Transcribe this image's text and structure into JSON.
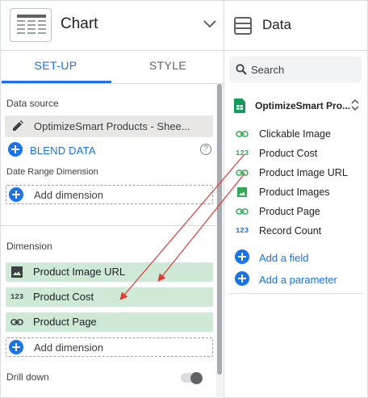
{
  "chart_panel": {
    "title": "Chart",
    "tabs": [
      {
        "label": "SET-UP",
        "active": true
      },
      {
        "label": "STYLE",
        "active": false
      }
    ],
    "data_source": {
      "section_label": "Data source",
      "name": "OptimizeSmart Products - Shee...",
      "blend_label": "BLEND DATA",
      "help_glyph": "?"
    },
    "date_range": {
      "section_label": "Date Range Dimension",
      "add_label": "Add dimension"
    },
    "dimension": {
      "section_label": "Dimension",
      "items": [
        {
          "icon": "image-icon",
          "type_glyph": "",
          "label": "Product Image URL"
        },
        {
          "icon": "number-icon",
          "type_glyph": "123",
          "label": "Product Cost"
        },
        {
          "icon": "link-icon",
          "type_glyph": "",
          "label": "Product Page"
        }
      ],
      "add_label": "Add dimension"
    },
    "drill_down": {
      "label": "Drill down",
      "enabled": false
    }
  },
  "data_panel": {
    "title": "Data",
    "search_placeholder": "Search",
    "source_name": "OptimizeSmart Pro...",
    "fields": [
      {
        "icon": "link-icon",
        "type_glyph": "",
        "label": "Clickable Image"
      },
      {
        "icon": "number-icon",
        "type_glyph": "123",
        "label": "Product Cost"
      },
      {
        "icon": "link-icon",
        "type_glyph": "",
        "label": "Product Image URL"
      },
      {
        "icon": "image-icon",
        "type_glyph": "",
        "label": "Product Images"
      },
      {
        "icon": "link-icon",
        "type_glyph": "",
        "label": "Product Page"
      },
      {
        "icon": "number-icon",
        "type_glyph": "123",
        "label": "Record Count"
      }
    ],
    "add_field_label": "Add a field",
    "add_parameter_label": "Add a parameter"
  },
  "colors": {
    "accent_blue": "#1a73e8",
    "dimension_green": "#ceead6",
    "field_icon_green": "#34a853",
    "annotation_red": "#e53935"
  }
}
